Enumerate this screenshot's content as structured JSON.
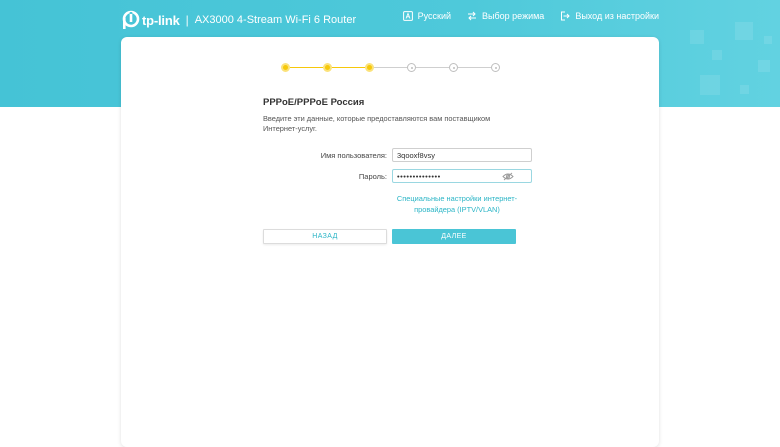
{
  "header": {
    "brand": "tp-link",
    "separator": "|",
    "model": "AX3000 4-Stream Wi-Fi 6 Router",
    "nav": {
      "language": {
        "label": "Русский",
        "icon": "language-icon"
      },
      "mode": {
        "label": "Выбор режима",
        "icon": "swap-arrows-icon"
      },
      "logout": {
        "label": "Выход из настройки",
        "icon": "logout-icon"
      }
    }
  },
  "wizard": {
    "total_steps": 6,
    "current_step": 3,
    "colors": {
      "done": "#f6c80b",
      "pending": "#bfbfbf"
    }
  },
  "form": {
    "title": "PPPoE/PPPoE Россия",
    "description": "Введите эти данные, которые предоставляются вам поставщиком Интернет-услуг.",
    "username": {
      "label": "Имя пользователя:",
      "value": "3qooxf8vsy"
    },
    "password": {
      "label": "Пароль:",
      "value": "••••••••••••••",
      "icon": "eye-hidden-icon"
    },
    "advanced_link": "Специальные настройки интернет-провайдера (IPTV/VLAN)",
    "back_label": "НАЗАД",
    "next_label": "ДАЛЕЕ"
  },
  "colors": {
    "accent": "#4ac5d6",
    "link": "#2bb5c6",
    "header_bg": "#4ec9da"
  }
}
